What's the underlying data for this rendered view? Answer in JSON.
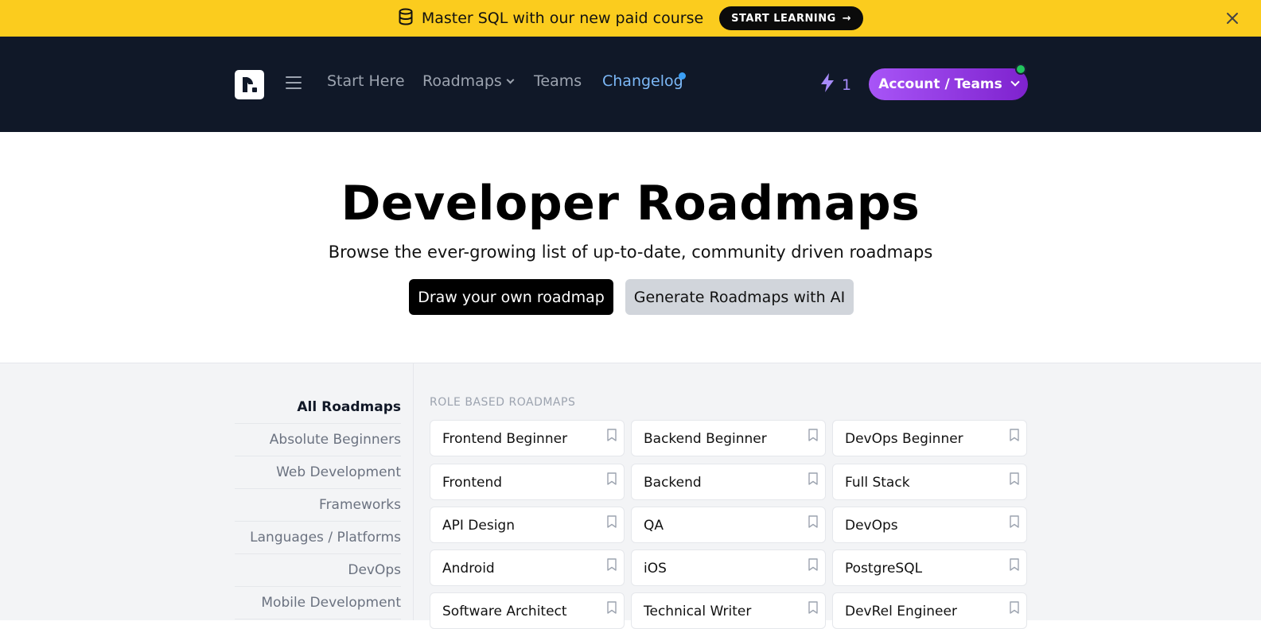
{
  "banner": {
    "text": "Master SQL with our new paid course",
    "cta": "START LEARNING",
    "cta_arrow": "→",
    "icon": "database-icon"
  },
  "nav": {
    "links": {
      "start_here": "Start Here",
      "roadmaps": "Roadmaps",
      "teams": "Teams",
      "changelog": "Changelog"
    },
    "streak_count": "1",
    "account_button": "Account / Teams"
  },
  "hero": {
    "title": "Developer Roadmaps",
    "subtitle": "Browse the ever-growing list of up-to-date, community driven roadmaps",
    "primary_button": "Draw your own roadmap",
    "secondary_button": "Generate Roadmaps with AI"
  },
  "sidebar": {
    "items": [
      {
        "label": "All Roadmaps",
        "active": true
      },
      {
        "label": "Absolute Beginners",
        "active": false
      },
      {
        "label": "Web Development",
        "active": false
      },
      {
        "label": "Frameworks",
        "active": false
      },
      {
        "label": "Languages / Platforms",
        "active": false
      },
      {
        "label": "DevOps",
        "active": false
      },
      {
        "label": "Mobile Development",
        "active": false
      }
    ]
  },
  "roadmaps": {
    "section_title": "ROLE BASED ROADMAPS",
    "cards": [
      "Frontend Beginner",
      "Backend Beginner",
      "DevOps Beginner",
      "Frontend",
      "Backend",
      "Full Stack",
      "API Design",
      "QA",
      "DevOps",
      "Android",
      "iOS",
      "PostgreSQL",
      "Software Architect",
      "Technical Writer",
      "DevRel Engineer"
    ]
  },
  "colors": {
    "banner_bg": "#fbcc1e",
    "nav_bg": "#101828",
    "accent_purple": "#9333ea",
    "changelog_blue": "#7cb8f7",
    "online_green": "#22c55e"
  }
}
